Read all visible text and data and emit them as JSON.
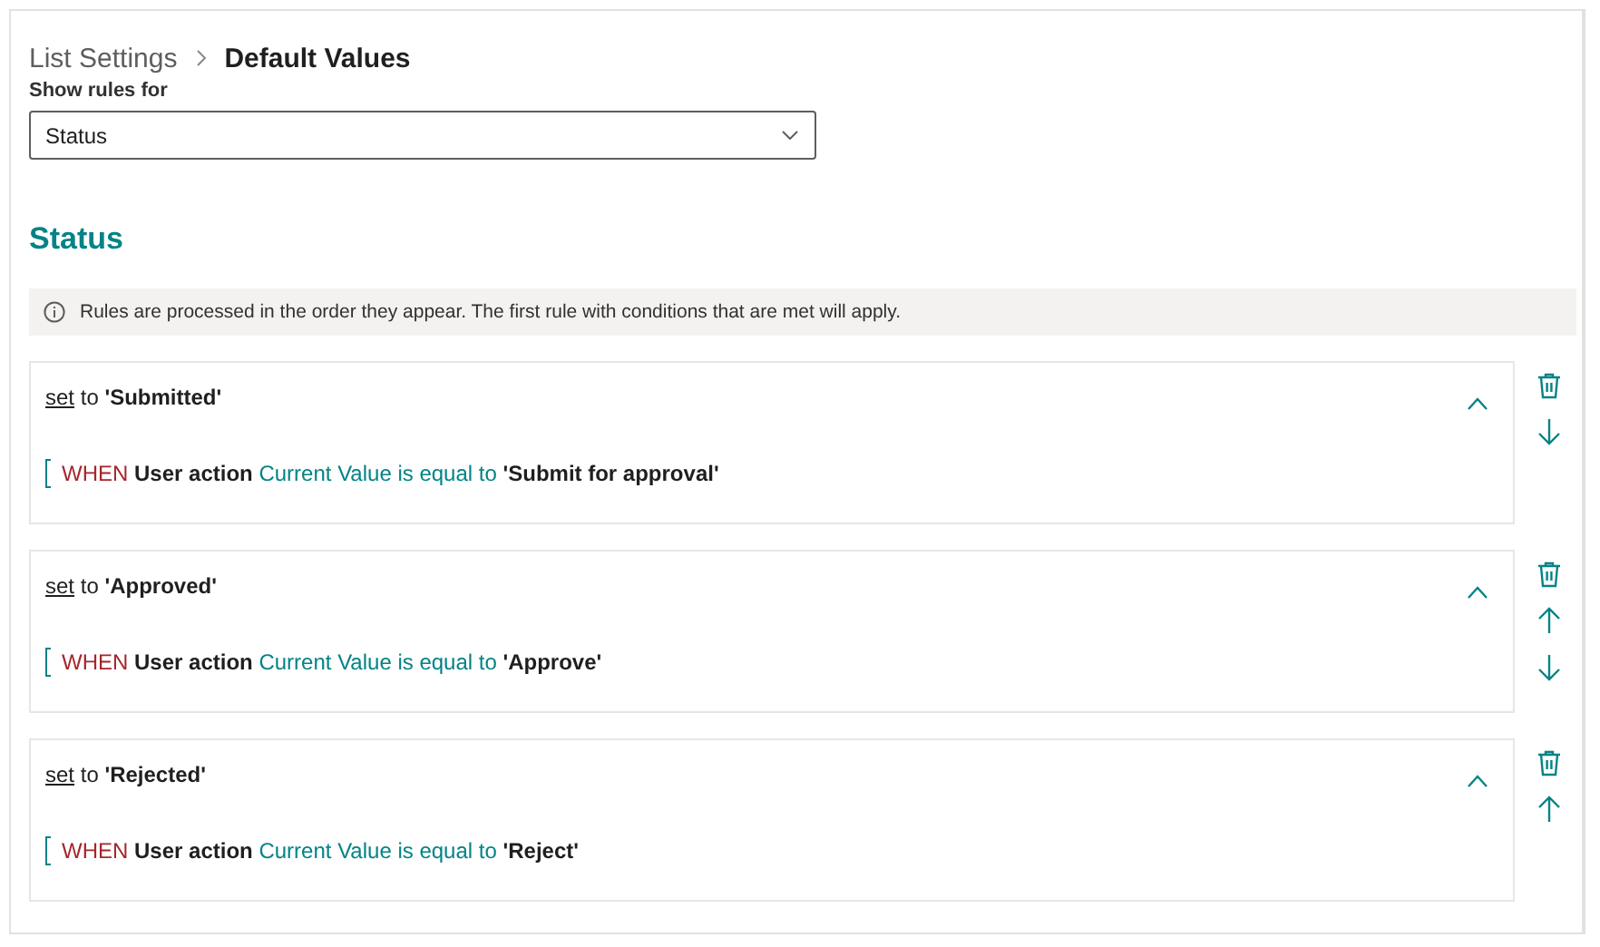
{
  "breadcrumb": {
    "parent": "List Settings",
    "current": "Default Values"
  },
  "field_label": "Show rules for",
  "dropdown": {
    "value": "Status"
  },
  "section_title": "Status",
  "info_message": "Rules are processed in the order they appear. The first rule with conditions that are met will apply.",
  "rules": [
    {
      "set_link": "set",
      "set_text": "to",
      "value": "'Submitted'",
      "expanded": true,
      "condition": {
        "keyword": "WHEN",
        "field": "User action",
        "operator": "Current Value is equal to",
        "value": "'Submit for approval'"
      },
      "actions": [
        {
          "kind": "delete"
        },
        {
          "kind": "move_down"
        }
      ]
    },
    {
      "set_link": "set",
      "set_text": "to",
      "value": "'Approved'",
      "expanded": true,
      "condition": {
        "keyword": "WHEN",
        "field": "User action",
        "operator": "Current Value is equal to",
        "value": "'Approve'"
      },
      "actions": [
        {
          "kind": "delete"
        },
        {
          "kind": "move_up"
        },
        {
          "kind": "move_down"
        }
      ]
    },
    {
      "set_link": "set",
      "set_text": "to",
      "value": "'Rejected'",
      "expanded": true,
      "condition": {
        "keyword": "WHEN",
        "field": "User action",
        "operator": "Current Value is equal to",
        "value": "'Reject'"
      },
      "actions": [
        {
          "kind": "delete"
        },
        {
          "kind": "move_up"
        }
      ]
    }
  ]
}
